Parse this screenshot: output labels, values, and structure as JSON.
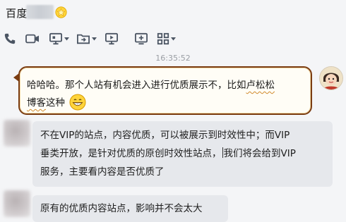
{
  "header": {
    "contact_name": "百度"
  },
  "toolbar": {
    "icons": [
      "phone-icon",
      "video-icon",
      "screen-share-icon",
      "file-transfer-icon",
      "remote-desktop-icon",
      "add-app-icon",
      "more-apps-icon"
    ]
  },
  "timestamp": "16:35:52",
  "messages": {
    "mine": {
      "before": "哈哈哈。那个人站有机会进入进行优质展示不，比如",
      "link1": "卢松松",
      "link2": "博客",
      "after": "这种"
    },
    "reply1": {
      "line1": "不在VIP的站点，内容优质，可以被展示到时效性中；而VIP",
      "line2a": "垂类开放，是针对优质的原创时效性站点，",
      "line2b": "我们将会给到VIP",
      "line3": "服务，主要看内容是否优质了"
    },
    "reply2": {
      "text": "原有的优质内容站点，影响并不会太大"
    }
  },
  "colors": {
    "accent_border": "#7a3c12",
    "bubble_other": "#e6e8ec",
    "background": "#f4f5f7",
    "star": "#f5b800"
  }
}
